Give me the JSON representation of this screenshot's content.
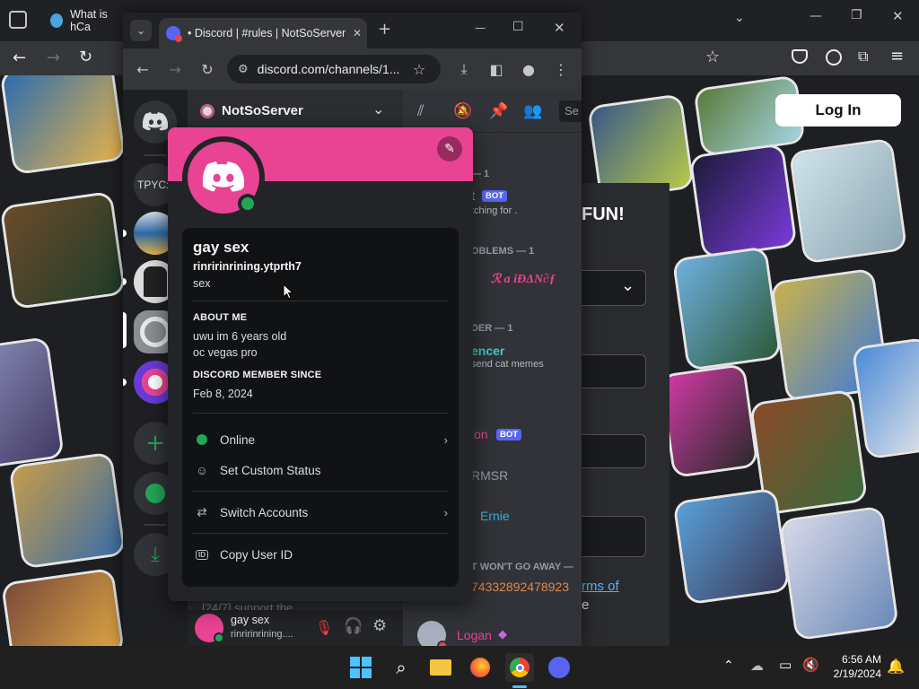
{
  "bg_browser": {
    "tab_title": "What is hCa",
    "login_button": "Log In",
    "heading_fragment": "FUN!",
    "link_fragment": "rms of",
    "text_fragment": "e"
  },
  "window": {
    "tab_title": "• Discord | #rules | NotSoServer",
    "url": "discord.com/channels/1...",
    "new_tab_glyph": "+",
    "minimize_glyph": "—",
    "maximize_glyph": "☐",
    "close_glyph": "✕"
  },
  "server": {
    "name": "NotSoServer",
    "search_placeholder": "Se"
  },
  "rail": {
    "server_text": "TPYC:"
  },
  "channel_peek": {
    "text_items": [
      "— 1",
      "t",
      "tching for .",
      "OBLEMS — 1",
      "ℛ a iÐΔN∂ƒ",
      "DER — 1",
      "encer",
      "send cat memes",
      "lon",
      "RMSR",
      "Ernie",
      "T WON'T GO AWAY —",
      "74332892478923",
      "Logan",
      "[24/7] support the"
    ],
    "bot_badge": "BOT"
  },
  "popout": {
    "display_name": "gay sex",
    "username": "rinririnrining.ytprth7",
    "pronouns": "sex",
    "about_heading": "ABOUT ME",
    "about_lines": [
      "uwu im 6 years old",
      "oc vegas pro"
    ],
    "member_since_heading": "DISCORD MEMBER SINCE",
    "member_since": "Feb 8, 2024",
    "status": "Online",
    "custom_status": "Set Custom Status",
    "switch_accounts": "Switch Accounts",
    "copy_id": "Copy User ID"
  },
  "user_panel": {
    "name": "gay sex",
    "username": "rinririnrining...."
  },
  "taskbar": {
    "time": "6:56 AM",
    "date": "2/19/2024"
  },
  "colors": {
    "banner": "#e94393",
    "online": "#23a55a",
    "discord_blurple": "#5865f2"
  }
}
